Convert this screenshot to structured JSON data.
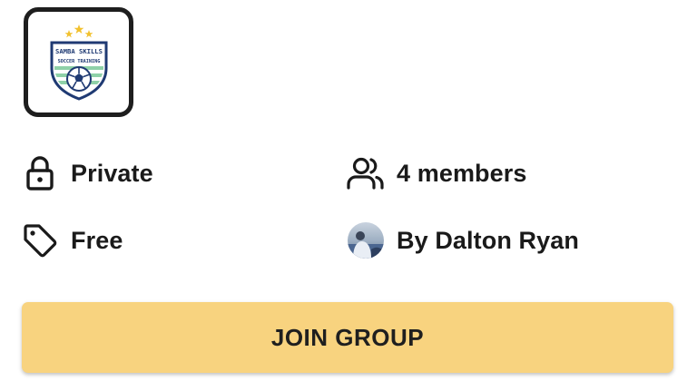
{
  "group": {
    "logo": {
      "title_line": "SAMBA SKILLS",
      "subtitle_line": "SOCCER TRAINING",
      "accent_color": "#8fd1a8",
      "navy_color": "#1f3a73",
      "star_color": "#f2c12e"
    },
    "privacy": {
      "label": "Private",
      "icon": "lock-icon"
    },
    "members": {
      "label": "4 members",
      "icon": "people-icon"
    },
    "price": {
      "label": "Free",
      "icon": "tag-icon"
    },
    "owner": {
      "label": "By Dalton Ryan",
      "icon": "avatar"
    }
  },
  "actions": {
    "join_label": "JOIN GROUP",
    "join_color": "#f8d37f"
  }
}
